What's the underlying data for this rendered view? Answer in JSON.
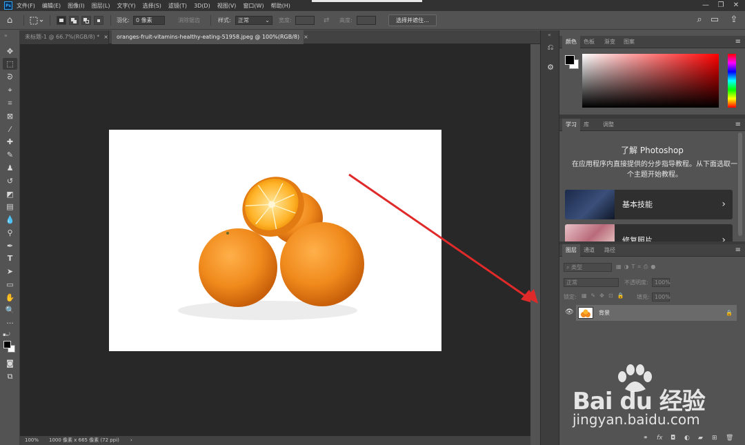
{
  "menubar": {
    "logo": "Ps",
    "items": [
      "文件(F)",
      "编辑(E)",
      "图像(I)",
      "图层(L)",
      "文字(Y)",
      "选择(S)",
      "滤镜(T)",
      "3D(D)",
      "视图(V)",
      "窗口(W)",
      "帮助(H)"
    ],
    "win_minimize": "—",
    "win_restore": "❐",
    "win_close": "✕"
  },
  "options": {
    "feather_label": "羽化:",
    "feather_value": "0 像素",
    "antialias_label": "消除锯齿",
    "style_label": "样式:",
    "style_value": "正常",
    "width_label": "宽度:",
    "height_label": "高度:",
    "select_mask_button": "选择并遮住..."
  },
  "tabs": [
    {
      "label": "未标题-1 @ 66.7%(RGB/8) *",
      "active": false
    },
    {
      "label": "oranges-fruit-vitamins-healthy-eating-51958.jpeg @ 100%(RGB/8)",
      "active": true
    }
  ],
  "tab_close_glyph": "×",
  "status": {
    "zoom": "100%",
    "doc_info": "1000 像素 x 665 像素 (72 ppi)",
    "arrow": "›"
  },
  "color_panel": {
    "tabs": [
      "颜色",
      "色板",
      "渐变",
      "图案"
    ]
  },
  "learn_panel": {
    "tabs": [
      "学习",
      "库",
      "调整"
    ],
    "title": "了解 Photoshop",
    "description": "在应用程序内直接提供的分步指导教程。从下面选取一个主题开始教程。",
    "cards": [
      {
        "label": "基本技能"
      },
      {
        "label": "修复照片"
      }
    ]
  },
  "layers_panel": {
    "tabs": [
      "图层",
      "通道",
      "路径"
    ],
    "filter_placeholder": "类型",
    "blend_mode": "正常",
    "opacity_label": "不透明度:",
    "opacity_value": "100%",
    "lock_label": "锁定:",
    "fill_label": "填充:",
    "fill_value": "100%",
    "layers": [
      {
        "name": "背景",
        "visible": true,
        "locked": true
      }
    ]
  },
  "watermark": {
    "brand": "Bai du 经验",
    "sub": "jingyan.baidu.com"
  },
  "colors": {
    "app_bg": "#535353",
    "canvas_bg": "#282828",
    "menubar_bg": "#323232",
    "accent_red": "#e02a2a",
    "orange": "#f08a1c"
  }
}
